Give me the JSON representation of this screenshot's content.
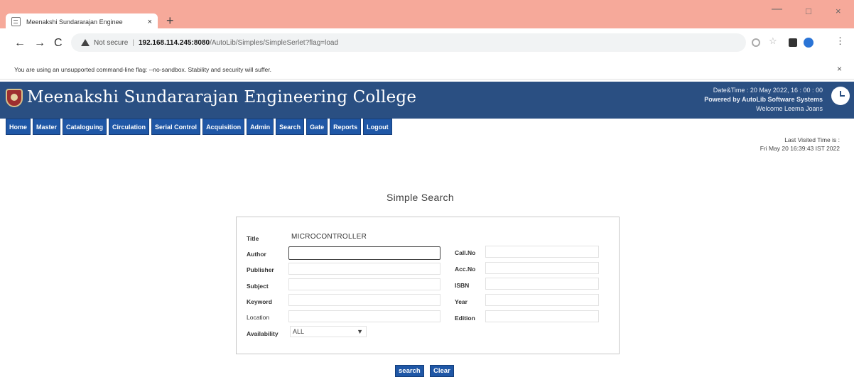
{
  "browser": {
    "tab_title": "Meenakshi Sundararajan Enginee",
    "tab_close": "×",
    "new_tab": "+",
    "window_min": "—",
    "window_max": "□",
    "window_close": "×",
    "not_secure": "Not secure",
    "url_separator": "|",
    "url_host": "192.168.114.245:8080",
    "url_path": "/AutoLib/Simples/SimpleSerlet?flag=load",
    "nav_back": "←",
    "nav_forward": "→",
    "nav_reload": "C",
    "bookmark_star": "☆",
    "menu_dots": "⋮",
    "infobar_text": "You are using an unsupported command-line flag: --no-sandbox. Stability and security will suffer.",
    "infobar_close": "×"
  },
  "header": {
    "college_name": "Meenakshi Sundararajan Engineering College",
    "datetime": "Date&Time : 20 May 2022, 16 : 00 : 00",
    "powered_by": "Powered by AutoLib Software Systems",
    "welcome": "Welcome    Leema Joans"
  },
  "menu": {
    "items": [
      "Home",
      "Master",
      "Cataloguing",
      "Circulation",
      "Serial Control",
      "Acquisition",
      "Admin",
      "Search",
      "Gate",
      "Reports",
      "Logout"
    ]
  },
  "last_visited": {
    "label": "Last Visited Time is :",
    "value": "Fri May 20 16:39:43 IST 2022"
  },
  "search": {
    "heading": "Simple Search",
    "title_label": "Title",
    "title_value": "MICROCONTROLLER",
    "left_labels": [
      "Author",
      "Publisher",
      "Subject",
      "Keyword",
      "Location"
    ],
    "right_labels": [
      "Call.No",
      "Acc.No",
      "ISBN",
      "Year",
      "Edition"
    ],
    "availability_label": "Availability",
    "availability_value": "ALL",
    "search_button": "search",
    "clear_button": "Clear"
  }
}
